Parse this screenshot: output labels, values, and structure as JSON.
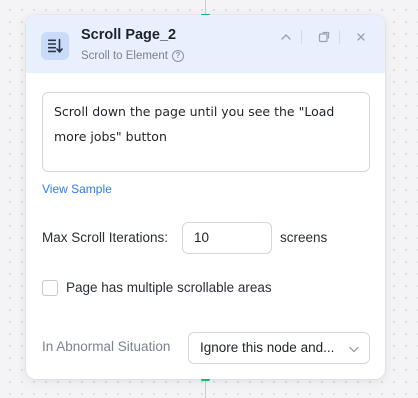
{
  "node": {
    "title": "Scroll Page_2",
    "subtitle": "Scroll to Element",
    "icon": "scroll-page-icon",
    "header_actions": [
      "chevron-up-icon",
      "popout-icon",
      "close-icon"
    ]
  },
  "instruction": {
    "value": "Scroll down the page until you see the \"Load more jobs\" button"
  },
  "view_sample": {
    "label": "View Sample"
  },
  "max_scroll": {
    "label": "Max Scroll Iterations:",
    "value": "10",
    "unit": "screens"
  },
  "multi_scroll": {
    "label": "Page has multiple scrollable areas",
    "checked": false
  },
  "abnormal": {
    "label": "In Abnormal Situation",
    "selected": "Ignore this node and..."
  },
  "colors": {
    "header_bg": "#e8f0fd",
    "accent": "#2f7bf6",
    "connector": "#16c17a"
  }
}
